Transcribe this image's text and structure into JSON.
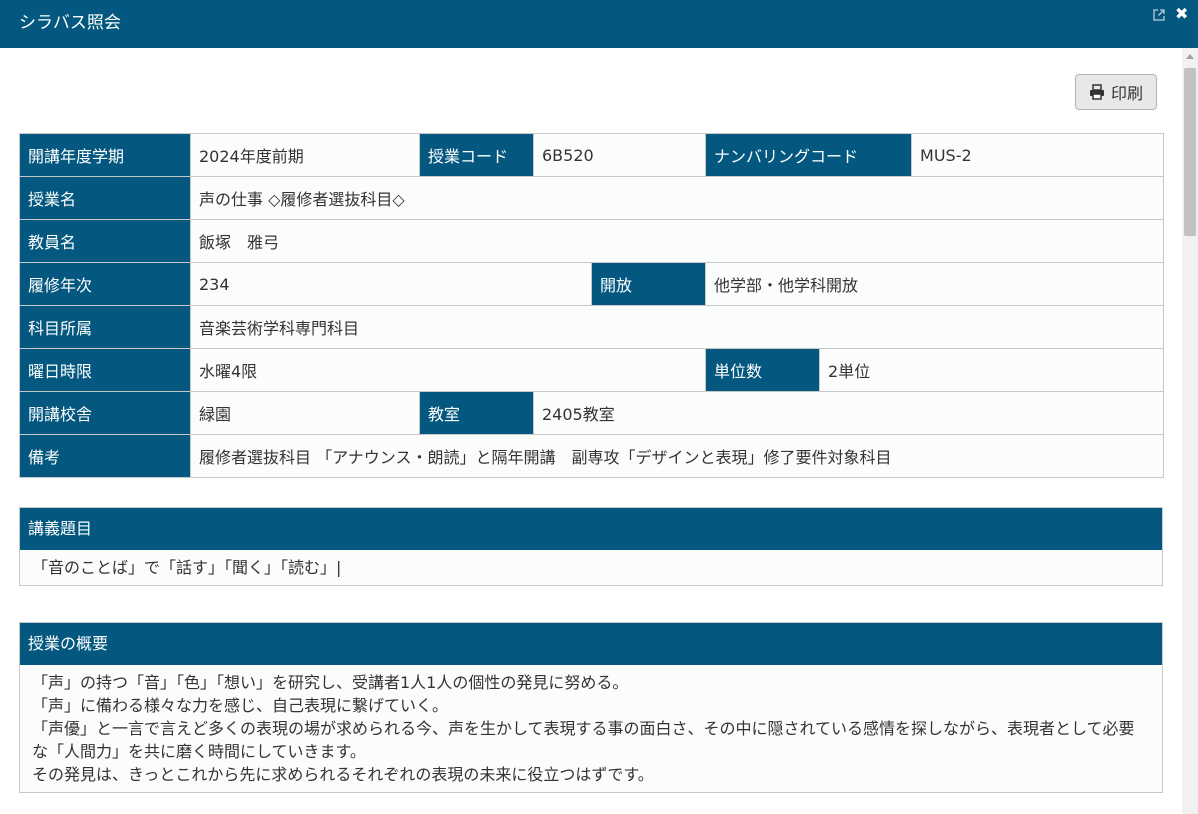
{
  "window": {
    "title": "シラバス照会"
  },
  "toolbar": {
    "print_label": "印刷"
  },
  "info": {
    "row1": {
      "h1": "開講年度学期",
      "v1": "2024年度前期",
      "h2": "授業コード",
      "v2": "6B520",
      "h3": "ナンバリングコード",
      "v3": "MUS-2"
    },
    "row2": {
      "h1": "授業名",
      "v1": "声の仕事 ◇履修者選抜科目◇"
    },
    "row3": {
      "h1": "教員名",
      "v1": "飯塚　雅弓"
    },
    "row4": {
      "h1": "履修年次",
      "v1": "234",
      "h2": "開放",
      "v2": "他学部・他学科開放"
    },
    "row5": {
      "h1": "科目所属",
      "v1": "音楽芸術学科専門科目"
    },
    "row6": {
      "h1": "曜日時限",
      "v1": "水曜4限",
      "h2": "単位数",
      "v2": "2単位"
    },
    "row7": {
      "h1": "開講校舎",
      "v1": "緑園",
      "h2": "教室",
      "v2": "2405教室"
    },
    "row8": {
      "h1": "備考",
      "v1": "履修者選抜科目 「アナウンス・朗読」と隔年開講　副専攻「デザインと表現」修了要件対象科目"
    }
  },
  "lecture_topic": {
    "heading": "講義題目",
    "body": "「音のことば」で「話す」「聞く」「読む」|"
  },
  "overview": {
    "heading": "授業の概要",
    "lines": [
      "「声」の持つ「音」「色」「想い」を研究し、受講者1人1人の個性の発見に努める。",
      "「声」に備わる様々な力を感じ、自己表現に繋げていく。",
      "「声優」と一言で言えど多くの表現の場が求められる今、声を生かして表現する事の面白さ、その中に隠されている感情を探しながら、表現者として必要な「人間力」を共に磨く時間にしていきます。",
      "その発見は、きっとこれから先に求められるそれぞれの表現の未来に役立つはずです。"
    ]
  }
}
